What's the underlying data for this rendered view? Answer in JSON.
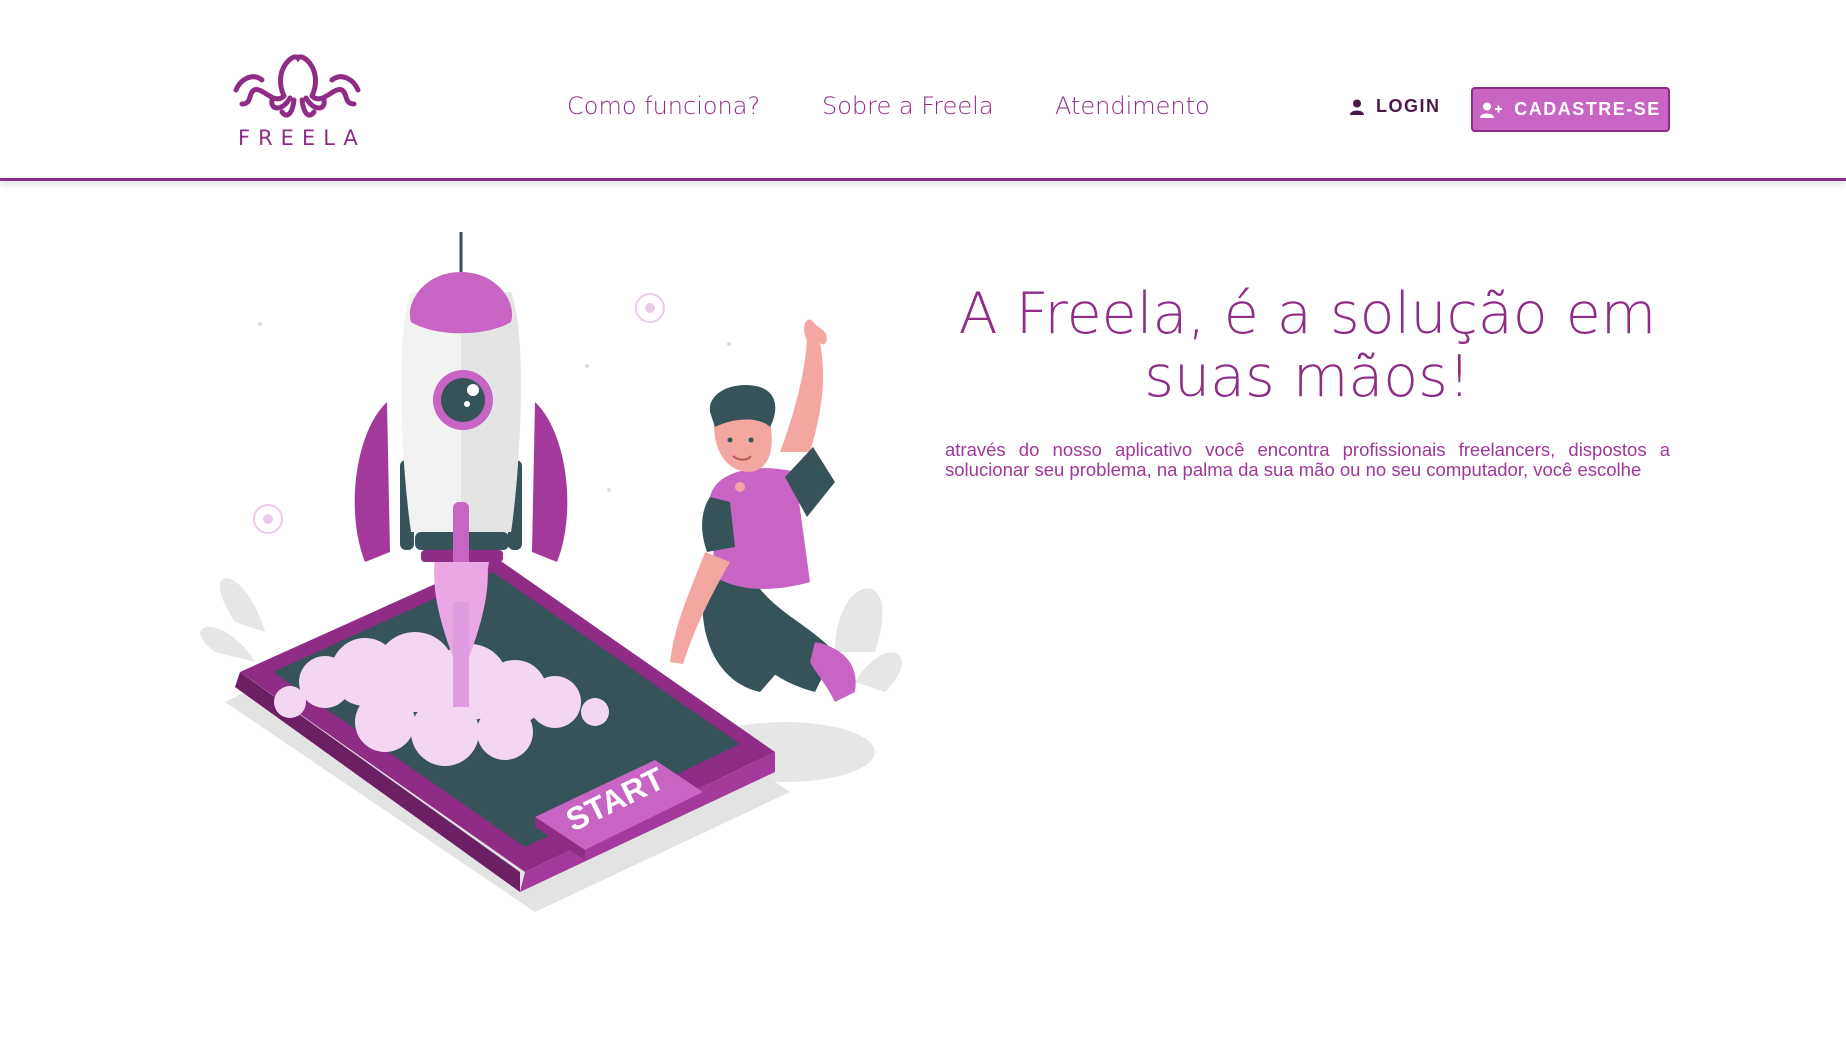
{
  "brand": {
    "name": "FREELA",
    "color": "#8e2c86",
    "accent": "#c865c4"
  },
  "nav": {
    "items": [
      {
        "label": "Como funciona?"
      },
      {
        "label": "Sobre a Freela"
      },
      {
        "label": "Atendimento"
      }
    ]
  },
  "auth": {
    "login_label": "LOGIN",
    "login_icon": "user-icon",
    "signup_label": "CADASTRE-SE",
    "signup_icon": "user-plus-icon"
  },
  "hero": {
    "title": "A Freela, é a solução em suas mãos!",
    "text": "através do nosso aplicativo você encontra profissionais freelancers, dispostos a solucionar seu problema, na palma da sua mão ou no seu computador, você escolhe",
    "illustration": {
      "button_text": "START"
    }
  }
}
